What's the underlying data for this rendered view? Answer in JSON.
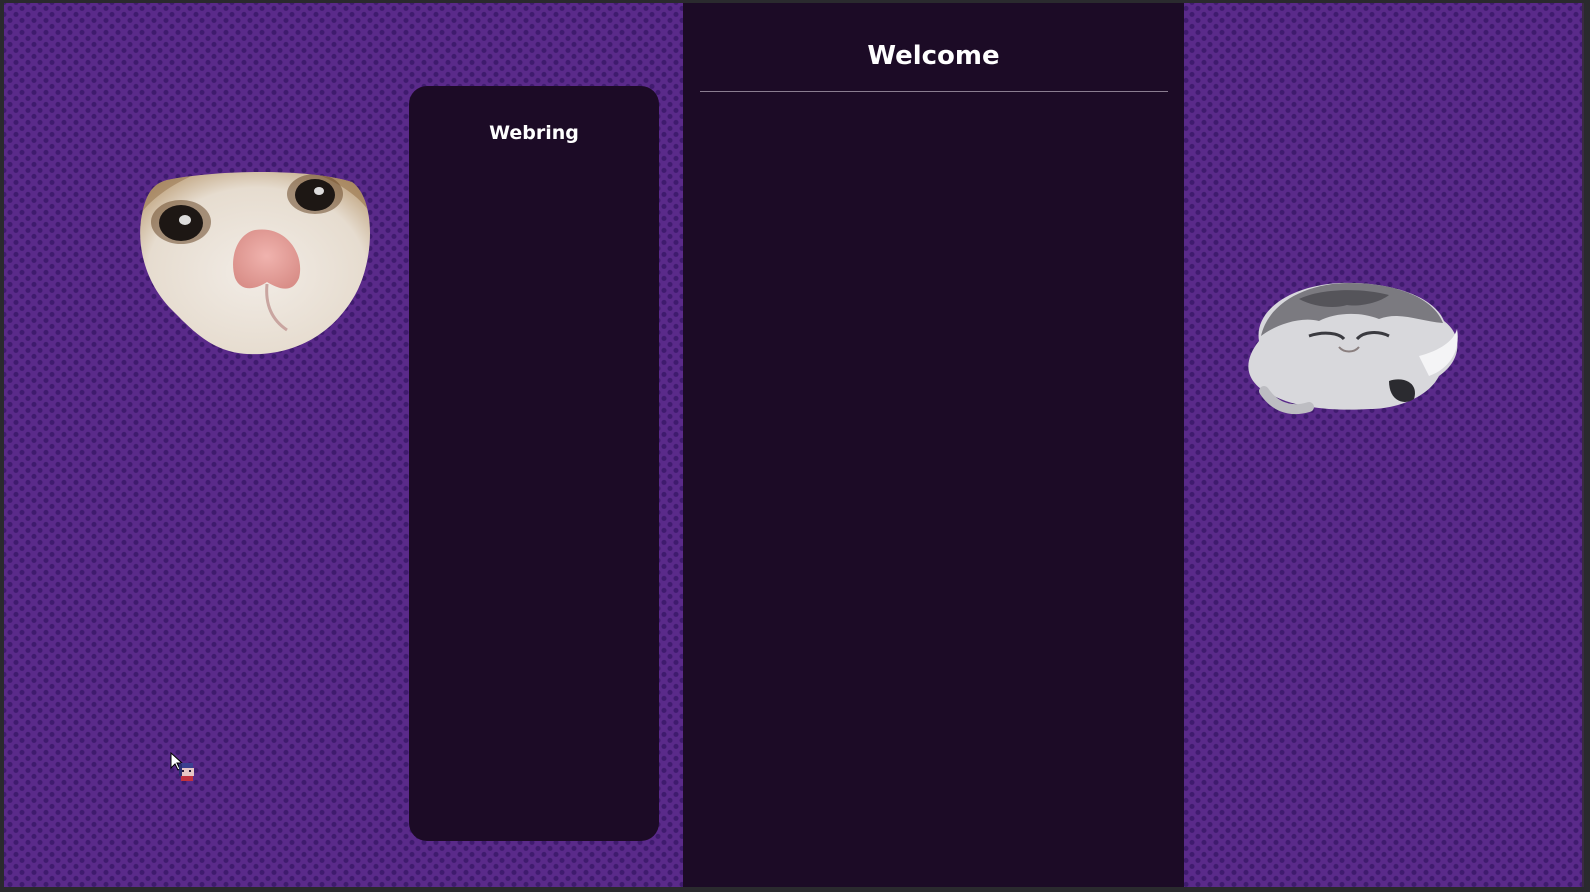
{
  "page": {
    "main_heading": "Welcome",
    "sidebar_heading": "Webring"
  },
  "images": {
    "left": "cat-face-closeup",
    "right": "fluffy-cat-cutout",
    "cursor": "pixel-character-cursor"
  },
  "colors": {
    "background": "#5a2a8a",
    "heart_pattern": "#3f1b6e",
    "panel": "#1c0b26",
    "heading_text": "#ffffff",
    "divider": "#8a7d90"
  }
}
